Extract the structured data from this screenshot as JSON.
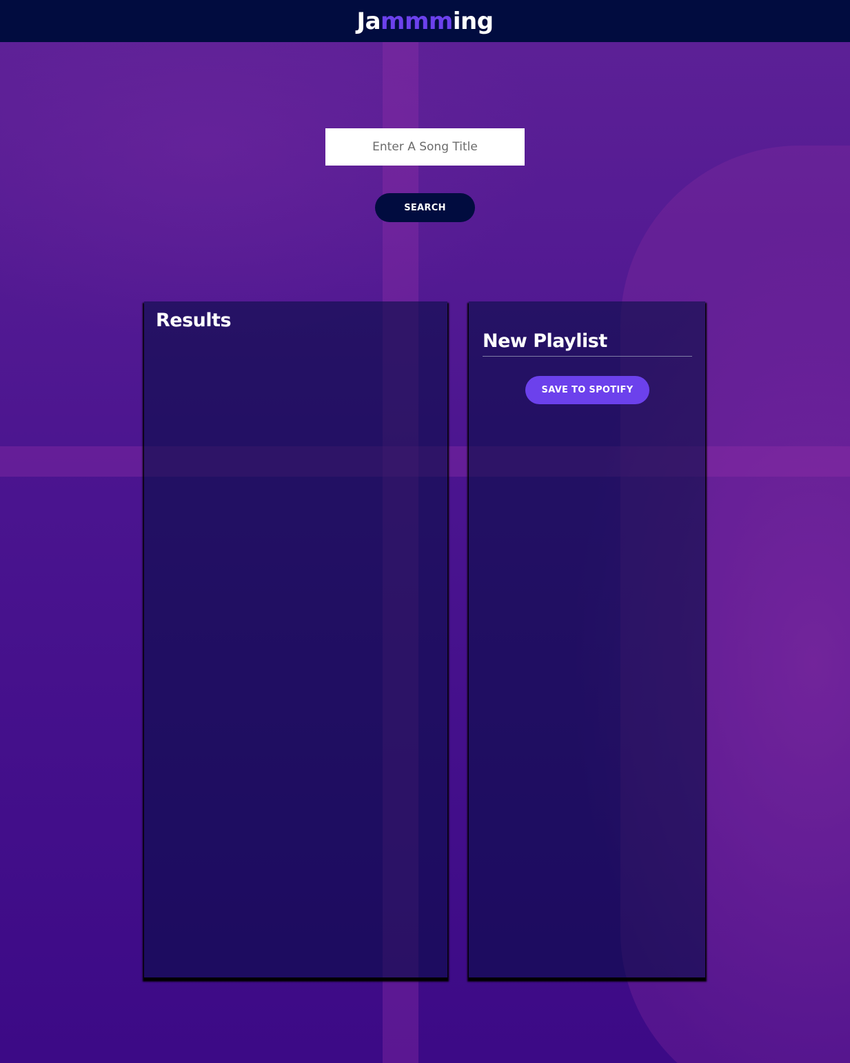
{
  "header": {
    "logo_prefix": "Ja",
    "logo_accent": "mmm",
    "logo_suffix": "ing"
  },
  "search": {
    "placeholder": "Enter A Song Title",
    "value": "",
    "button_label": "SEARCH"
  },
  "results": {
    "title": "Results",
    "tracks": []
  },
  "playlist": {
    "name": "New Playlist",
    "tracks": [],
    "save_label": "SAVE TO SPOTIFY"
  },
  "colors": {
    "header_bg": "#010c3f",
    "accent": "#6c41ec",
    "button_dark": "#010c3f",
    "background": "#3d0a84"
  }
}
